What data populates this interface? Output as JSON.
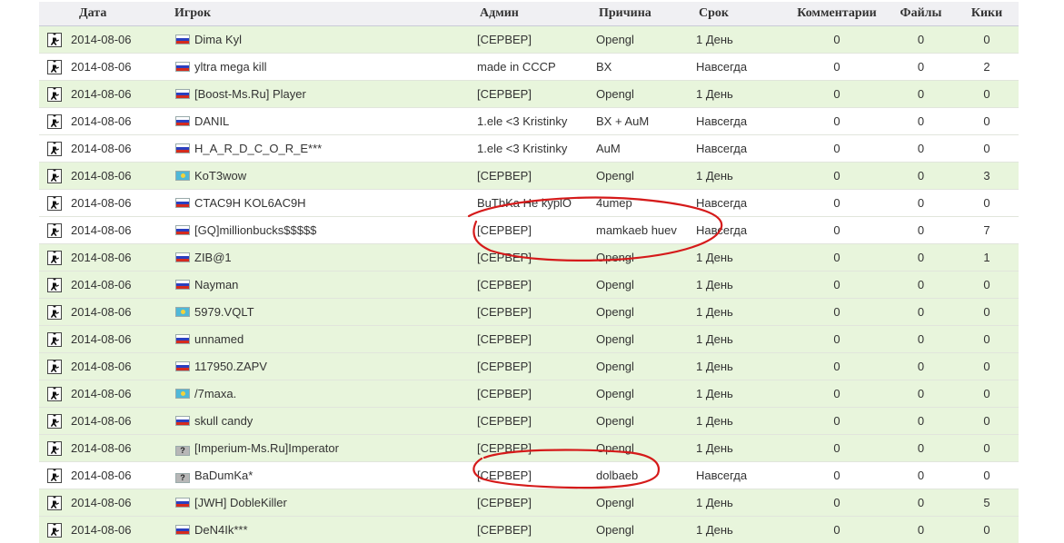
{
  "columns": {
    "icon": "",
    "date": "Дата",
    "player": "Игрок",
    "admin": "Админ",
    "reason": "Причина",
    "term": "Срок",
    "comments": "Комментарии",
    "files": "Файлы",
    "kicks": "Кики"
  },
  "icons": {
    "game": "counter-strike-game-icon",
    "unknown_flag": "?"
  },
  "colors": {
    "temp_row": "#e8f5dc",
    "perm_row": "#ffffff",
    "annotation": "#d51a1a"
  },
  "bans": [
    {
      "date": "2014-08-06",
      "flag": "ru",
      "player": "Dima Kyl",
      "admin": "[СЕРВЕР]",
      "reason": "Opengl",
      "term": "1 День",
      "comments": "0",
      "files": "0",
      "kicks": "0"
    },
    {
      "date": "2014-08-06",
      "flag": "ru",
      "player": "yltra mega kill",
      "admin": "made in CCCP",
      "reason": "BX",
      "term": "Навсегда",
      "comments": "0",
      "files": "0",
      "kicks": "2"
    },
    {
      "date": "2014-08-06",
      "flag": "ru",
      "player": "[Boost-Ms.Ru] Player",
      "admin": "[СЕРВЕР]",
      "reason": "Opengl",
      "term": "1 День",
      "comments": "0",
      "files": "0",
      "kicks": "0"
    },
    {
      "date": "2014-08-06",
      "flag": "ru",
      "player": "DANIL",
      "admin": "1.ele <3 Kristinky",
      "reason": "BX + AuM",
      "term": "Навсегда",
      "comments": "0",
      "files": "0",
      "kicks": "0"
    },
    {
      "date": "2014-08-06",
      "flag": "ru",
      "player": "H_A_R_D_C_O_R_E***",
      "admin": "1.ele <3 Kristinky",
      "reason": "AuM",
      "term": "Навсегда",
      "comments": "0",
      "files": "0",
      "kicks": "0"
    },
    {
      "date": "2014-08-06",
      "flag": "kz",
      "player": "KoT3wow",
      "admin": "[СЕРВЕР]",
      "reason": "Opengl",
      "term": "1 День",
      "comments": "0",
      "files": "0",
      "kicks": "3"
    },
    {
      "date": "2014-08-06",
      "flag": "ru",
      "player": "CTAC9H KOL6AC9H",
      "admin": "BuTbKa He kyplO",
      "reason": "4umep",
      "term": "Навсегда",
      "comments": "0",
      "files": "0",
      "kicks": "0"
    },
    {
      "date": "2014-08-06",
      "flag": "ru",
      "player": "[GQ]millionbucks$$$$$",
      "admin": "[СЕРВЕР]",
      "reason": "mamkaeb huev",
      "term": "Навсегда",
      "comments": "0",
      "files": "0",
      "kicks": "7"
    },
    {
      "date": "2014-08-06",
      "flag": "ru",
      "player": "ZIB@1",
      "admin": "[СЕРВЕР]",
      "reason": "Opengl",
      "term": "1 День",
      "comments": "0",
      "files": "0",
      "kicks": "1"
    },
    {
      "date": "2014-08-06",
      "flag": "ru",
      "player": "Nayman",
      "admin": "[СЕРВЕР]",
      "reason": "Opengl",
      "term": "1 День",
      "comments": "0",
      "files": "0",
      "kicks": "0"
    },
    {
      "date": "2014-08-06",
      "flag": "kz",
      "player": "5979.VQLT",
      "admin": "[СЕРВЕР]",
      "reason": "Opengl",
      "term": "1 День",
      "comments": "0",
      "files": "0",
      "kicks": "0"
    },
    {
      "date": "2014-08-06",
      "flag": "ru",
      "player": "unnamed",
      "admin": "[СЕРВЕР]",
      "reason": "Opengl",
      "term": "1 День",
      "comments": "0",
      "files": "0",
      "kicks": "0"
    },
    {
      "date": "2014-08-06",
      "flag": "ru",
      "player": "117950.ZAPV",
      "admin": "[СЕРВЕР]",
      "reason": "Opengl",
      "term": "1 День",
      "comments": "0",
      "files": "0",
      "kicks": "0"
    },
    {
      "date": "2014-08-06",
      "flag": "kz",
      "player": "/7maxa.",
      "admin": "[СЕРВЕР]",
      "reason": "Opengl",
      "term": "1 День",
      "comments": "0",
      "files": "0",
      "kicks": "0"
    },
    {
      "date": "2014-08-06",
      "flag": "ru",
      "player": "skull candy",
      "admin": "[СЕРВЕР]",
      "reason": "Opengl",
      "term": "1 День",
      "comments": "0",
      "files": "0",
      "kicks": "0"
    },
    {
      "date": "2014-08-06",
      "flag": "unknown",
      "player": "[Imperium-Ms.Ru]Imperator",
      "admin": "[СЕРВЕР]",
      "reason": "Opengl",
      "term": "1 День",
      "comments": "0",
      "files": "0",
      "kicks": "0"
    },
    {
      "date": "2014-08-06",
      "flag": "unknown",
      "player": "BaDumKa*",
      "admin": "[СЕРВЕР]",
      "reason": "dolbaeb",
      "term": "Навсегда",
      "comments": "0",
      "files": "0",
      "kicks": "0"
    },
    {
      "date": "2014-08-06",
      "flag": "ru",
      "player": "[JWH] DobleKiller",
      "admin": "[СЕРВЕР]",
      "reason": "Opengl",
      "term": "1 День",
      "comments": "0",
      "files": "0",
      "kicks": "5"
    },
    {
      "date": "2014-08-06",
      "flag": "ru",
      "player": "DeN4Ik***",
      "admin": "[СЕРВЕР]",
      "reason": "Opengl",
      "term": "1 День",
      "comments": "0",
      "files": "0",
      "kicks": "0"
    }
  ]
}
